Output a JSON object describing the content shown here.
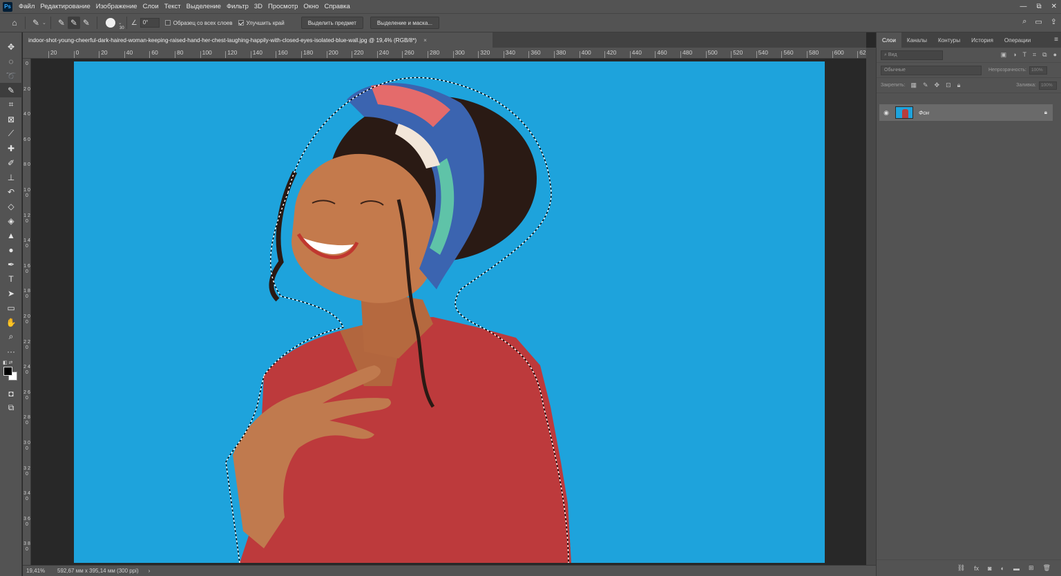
{
  "app": {
    "logo": "Ps"
  },
  "menu": [
    "Файл",
    "Редактирование",
    "Изображение",
    "Слои",
    "Текст",
    "Выделение",
    "Фильтр",
    "3D",
    "Просмотр",
    "Окно",
    "Справка"
  ],
  "window_controls": [
    "—",
    "⧉",
    "✕"
  ],
  "options": {
    "brush_size": "30",
    "angle": "0°",
    "sample_all_layers_label": "Образец со всех слоев",
    "sample_all_layers_checked": false,
    "enhance_edge_label": "Улучшить край",
    "enhance_edge_checked": true,
    "select_subject_button": "Выделить предмет",
    "select_mask_button": "Выделение и маска..."
  },
  "document": {
    "tab_title": "indoor-shot-young-cheerful-dark-haired-woman-keeping-raised-hand-her-chest-laughing-happily-with-closed-eyes-isolated-blue-wall.jpg @ 19,4% (RGB/8*)",
    "close": "×",
    "photo_bg_color": "#1ea3dc"
  },
  "ruler_top": [
    "20",
    "0",
    "20",
    "40",
    "60",
    "80",
    "100",
    "120",
    "140",
    "160",
    "180",
    "200",
    "220",
    "240",
    "260",
    "280",
    "300",
    "320",
    "340",
    "360",
    "380",
    "400",
    "420",
    "440",
    "460",
    "480",
    "500",
    "520",
    "540",
    "560",
    "580",
    "600",
    "62"
  ],
  "ruler_left": [
    "0",
    "2 0",
    "4 0",
    "6 0",
    "8 0",
    "1 0 0",
    "1 2 0",
    "1 4 0",
    "1 6 0",
    "1 8 0",
    "2 0 0",
    "2 2 0",
    "2 4 0",
    "2 6 0",
    "2 8 0",
    "3 0 0",
    "3 2 0",
    "3 4 0",
    "3 6 0",
    "3 8 0"
  ],
  "status": {
    "zoom": "19,41%",
    "doc_info": "592,67 мм x 395,14 мм (300 ppi)",
    "arrow": "›"
  },
  "panel": {
    "tabs": [
      "Слои",
      "Каналы",
      "Контуры",
      "История",
      "Операции"
    ],
    "active_tab": 0,
    "search_placeholder": "Вид",
    "blend_mode": "Обычные",
    "opacity_label": "Непрозрачность:",
    "opacity_value": "100%",
    "lock_label": "Закрепить:",
    "fill_label": "Заливка:",
    "fill_value": "100%",
    "layers": [
      {
        "name": "Фон",
        "visible": true,
        "locked": true
      }
    ]
  }
}
